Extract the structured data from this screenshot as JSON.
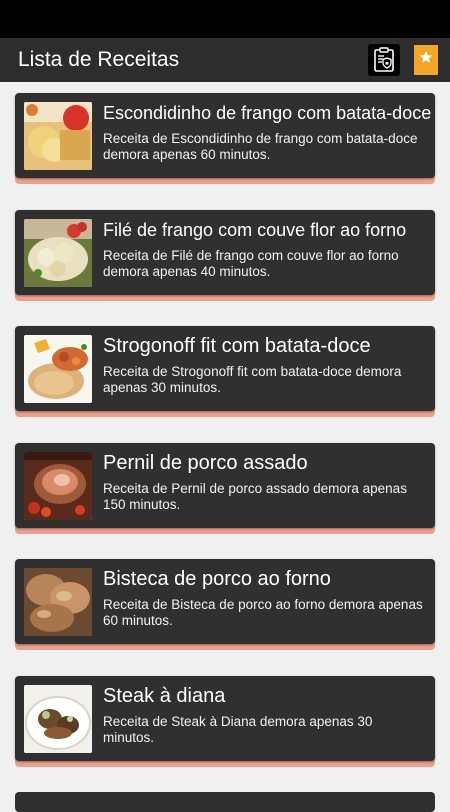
{
  "app": {
    "title": "Lista de Receitas",
    "policy_icon": "privacy-policy-icon",
    "favorite_icon": "bookmark-star-icon"
  },
  "colors": {
    "app_bar": "#2d2d2d",
    "card": "#303030",
    "card_accent": "#f0a08a",
    "favorite": "#f5a623"
  },
  "recipes": [
    {
      "title": "Escondidinho de frango com batata-doce",
      "description": "Receita de Escondidinho de frango com batata-doce demora apenas 60 minutos."
    },
    {
      "title": "Filé de frango com couve flor ao forno",
      "description": "Receita de Filé de frango com couve flor ao forno demora apenas 40 minutos."
    },
    {
      "title": "Strogonoff fit com batata-doce",
      "description": "Receita de Strogonoff fit com batata-doce demora apenas 30 minutos."
    },
    {
      "title": "Pernil de porco assado",
      "description": "Receita de Pernil de porco assado demora apenas 150 minutos."
    },
    {
      "title": "Bisteca de porco ao forno",
      "description": "Receita de Bisteca de porco ao forno demora apenas 60 minutos."
    },
    {
      "title": "Steak à diana",
      "description": "Receita de Steak à Diana demora apenas 30 minutos."
    }
  ]
}
